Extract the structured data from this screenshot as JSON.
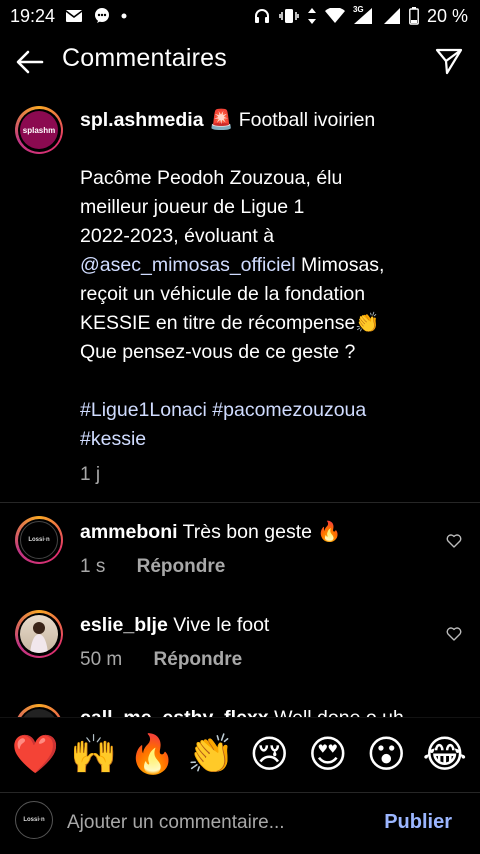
{
  "status_bar": {
    "time": "19:24",
    "network_label": "3G",
    "battery": "20 %"
  },
  "header": {
    "title": "Commentaires"
  },
  "post": {
    "username": "spl.ashmedia",
    "siren_emoji": "🚨",
    "topic": "Football ivoirien",
    "line1": "Pacôme Peodoh Zouzoua, élu",
    "line2": "meilleur joueur de Ligue 1",
    "line3": "2022-2023, évoluant à",
    "mention": "@asec_mimosas_officiel",
    "line4_rest": " Mimosas,",
    "line5": "reçoit un véhicule de la fondation",
    "line6": "KESSIE en titre de récompense👏",
    "line7": "Que pensez-vous de ce geste ?",
    "hashtags1": "#Ligue1Lonaci #pacomezouzoua",
    "hashtags2": "#kessie",
    "time": "1 j",
    "avatar_text": "splashm"
  },
  "comments": [
    {
      "username": "ammeboni",
      "text": "Très bon geste 🔥",
      "time": "1 s",
      "reply": "Répondre",
      "avatar_text": "Lossi·n"
    },
    {
      "username": "eslie_blje",
      "text": "Vive le foot",
      "time": "50 m",
      "reply": "Répondre"
    },
    {
      "username": "call_me_esthy_flexx",
      "text": "Well done o uh"
    }
  ],
  "emojis": [
    "❤️",
    "🙌",
    "🔥",
    "👏",
    "😢",
    "😍",
    "😮",
    "😂"
  ],
  "composer": {
    "placeholder": "Ajouter un commentaire...",
    "publish": "Publier",
    "avatar_text": "Lossi·n"
  },
  "colors": {
    "background": "#000000",
    "link": "#d0dcff",
    "publish": "#9bb6ff",
    "muted": "#a8a8a8"
  }
}
